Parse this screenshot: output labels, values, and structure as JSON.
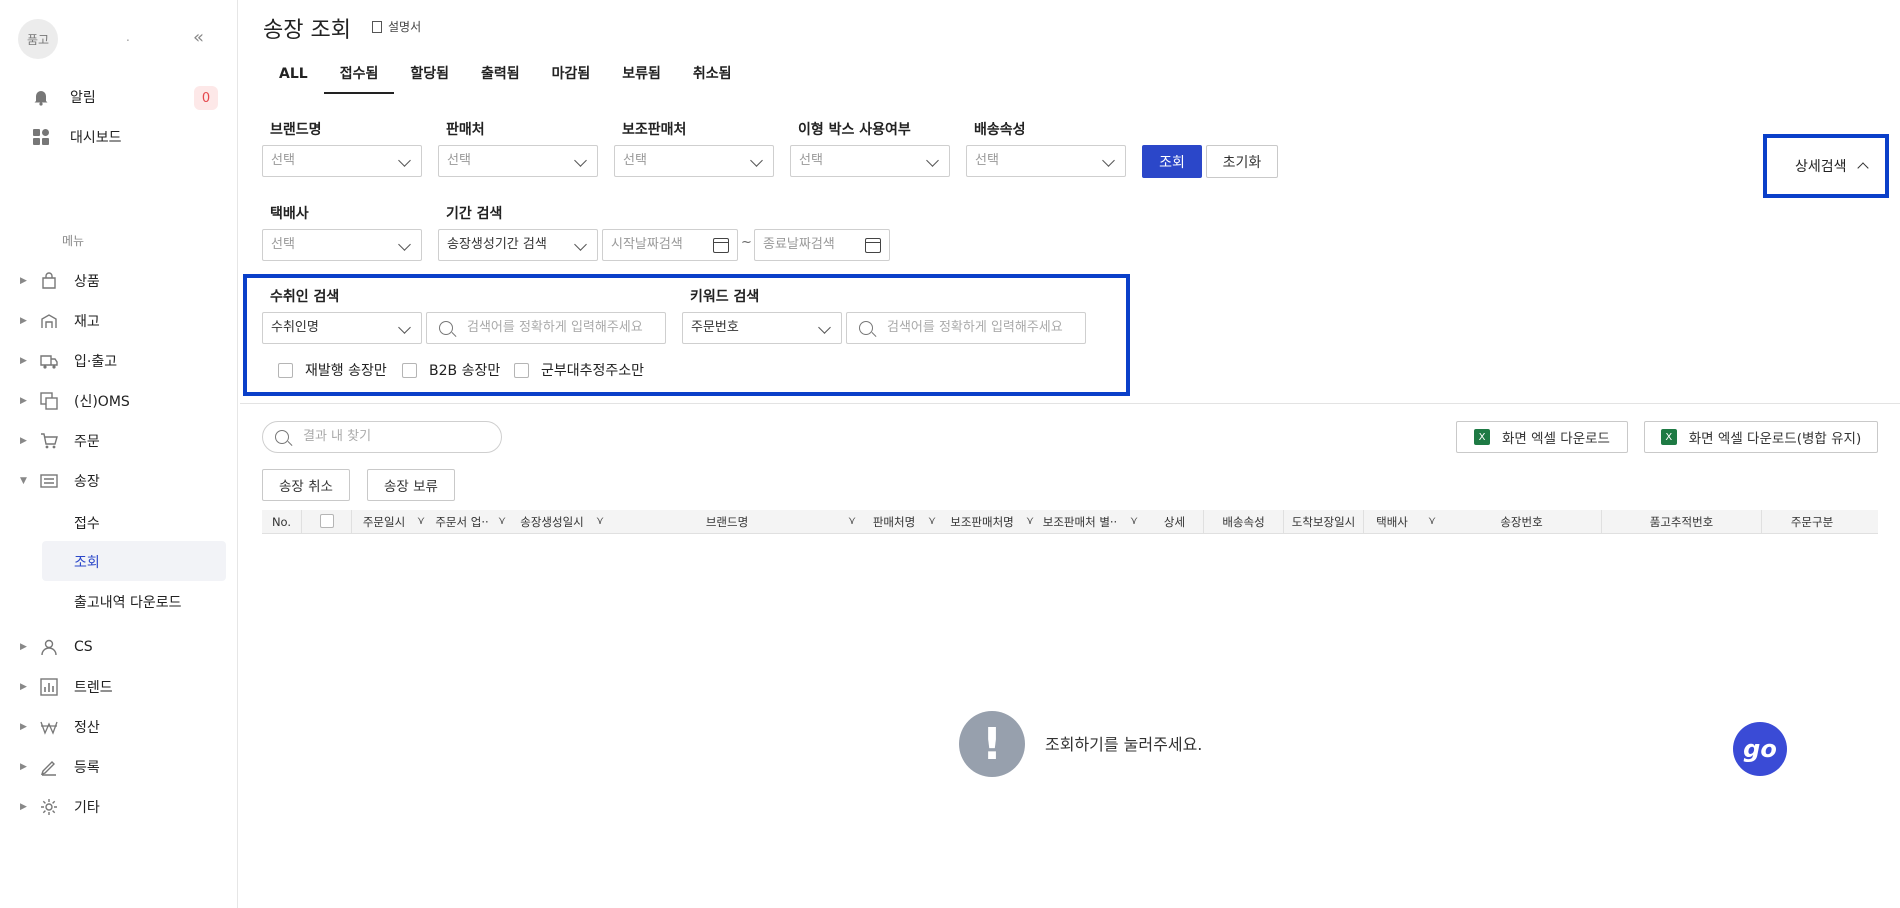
{
  "sidebar": {
    "avatar": "품고",
    "notice_label": "알림",
    "notice_count": "0",
    "dashboard_label": "대시보드",
    "menu_caption": "메뉴",
    "nav": [
      "상품",
      "재고",
      "입·출고",
      "(신)OMS",
      "주문",
      "송장",
      "CS",
      "트렌드",
      "정산",
      "등록",
      "기타"
    ],
    "sub": [
      "접수",
      "조회",
      "출고내역 다운로드"
    ]
  },
  "header": {
    "title": "송장 조회",
    "manual": "설명서"
  },
  "tabs": [
    "ALL",
    "접수됨",
    "할당됨",
    "출력됨",
    "마감됨",
    "보류됨",
    "취소됨"
  ],
  "filters": {
    "brand": {
      "label": "브랜드명",
      "value": "선택"
    },
    "seller": {
      "label": "판매처",
      "value": "선택"
    },
    "sub_seller": {
      "label": "보조판매처",
      "value": "선택"
    },
    "odd_box": {
      "label": "이형 박스 사용여부",
      "value": "선택"
    },
    "ship_attr": {
      "label": "배송속성",
      "value": "선택"
    },
    "courier": {
      "label": "택배사",
      "value": "선택"
    },
    "period": {
      "label": "기간 검색",
      "value": "송장생성기간 검색",
      "start_placeholder": "시작날짜검색",
      "end_placeholder": "종료날짜검색",
      "tilde": "~"
    },
    "recipient": {
      "label": "수취인 검색",
      "value": "수취인명",
      "placeholder": "검색어를 정확하게 입력해주세요"
    },
    "keyword": {
      "label": "키워드 검색",
      "value": "주문번호",
      "placeholder": "검색어를 정확하게 입력해주세요"
    },
    "checkboxes": [
      "재발행 송장만",
      "B2B 송장만",
      "군부대추정주소만"
    ],
    "search_button": "조회",
    "reset_button": "초기화",
    "detail_button": "상세검색"
  },
  "results": {
    "find_placeholder": "결과 내 찾기",
    "excel_button": "화면 엑셀 다운로드",
    "excel_merge_button": "화면 엑셀 다운로드(병합 유지)",
    "cancel_button": "송장 취소",
    "hold_button": "송장 보류",
    "columns": [
      "No.",
      "주문일시",
      "주문서 업··",
      "송장생성일시",
      "브랜드명",
      "판매처명",
      "보조판매처명",
      "보조판매처 별··",
      "상세",
      "배송속성",
      "도착보장일시",
      "택배사",
      "송장번호",
      "품고추적번호",
      "주문구분"
    ],
    "empty_message": "조회하기를 눌러주세요."
  },
  "chat_widget": "go"
}
